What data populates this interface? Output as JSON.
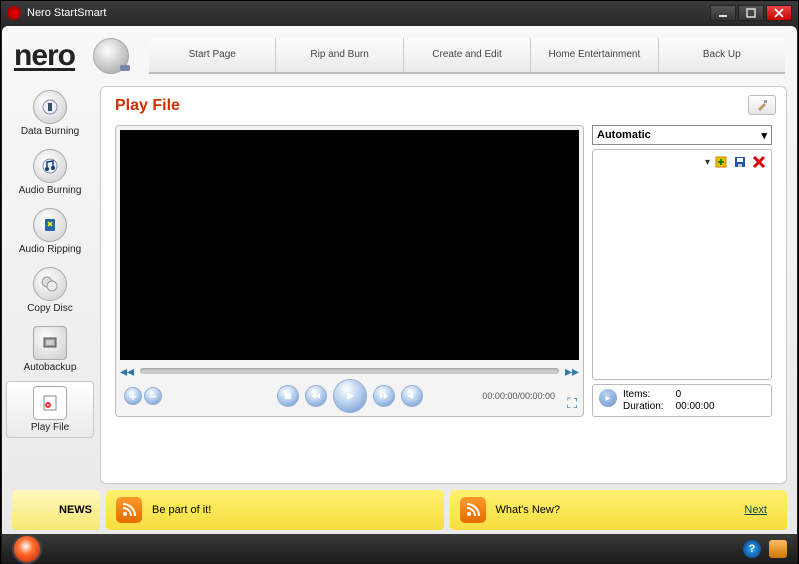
{
  "title": "Nero StartSmart",
  "logo": "nero",
  "topnav": [
    "Start Page",
    "Rip and Burn",
    "Create and Edit",
    "Home Entertainment",
    "Back Up"
  ],
  "sidebar": [
    {
      "label": "Data Burning"
    },
    {
      "label": "Audio Burning"
    },
    {
      "label": "Audio Ripping"
    },
    {
      "label": "Copy Disc"
    },
    {
      "label": "Autobackup"
    },
    {
      "label": "Play File"
    }
  ],
  "page_title": "Play File",
  "dropdown": "Automatic",
  "time_display": "00:00:00/00:00:00",
  "info": {
    "items_label": "Items:",
    "items_val": "0",
    "duration_label": "Duration:",
    "duration_val": "00:00:00"
  },
  "news": {
    "label": "NEWS",
    "items": [
      "Be part of it!",
      "What's New?"
    ],
    "next": "Next"
  }
}
